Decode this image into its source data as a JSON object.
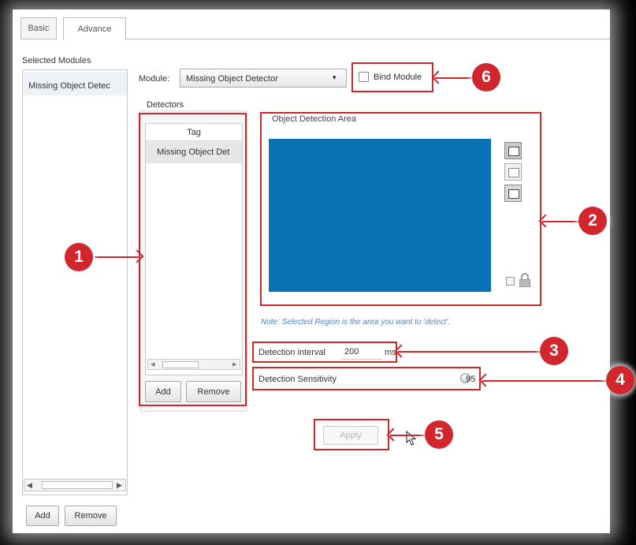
{
  "tabs": [
    {
      "label": "Basic"
    },
    {
      "label": "Advance"
    }
  ],
  "left_panel": {
    "title": "Selected Modules",
    "items": [
      "Missing Object Detec"
    ],
    "add_label": "Add",
    "remove_label": "Remove"
  },
  "module": {
    "label": "Module:",
    "selected": "Missing Object Detector",
    "bind_label": "Bind Module"
  },
  "detectors": {
    "title": "Detectors",
    "column_header": "Tag",
    "rows": [
      "Missing Object Det"
    ],
    "add_label": "Add",
    "remove_label": "Remove"
  },
  "area": {
    "title": "Object Detection Area",
    "note": "Note: Selected Region is the area you want to 'detect'.",
    "fill_color": "#0a72b4"
  },
  "interval": {
    "label": "Detection interval",
    "value": "200",
    "unit": "ms"
  },
  "sensitivity": {
    "label": "Detection Sensitivity",
    "value": "95"
  },
  "apply_label": "Apply",
  "callouts": [
    "1",
    "2",
    "3",
    "4",
    "5",
    "6"
  ],
  "colors": {
    "annotation_red": "#d0262c",
    "background": "#000000",
    "panel": "#ffffff"
  }
}
